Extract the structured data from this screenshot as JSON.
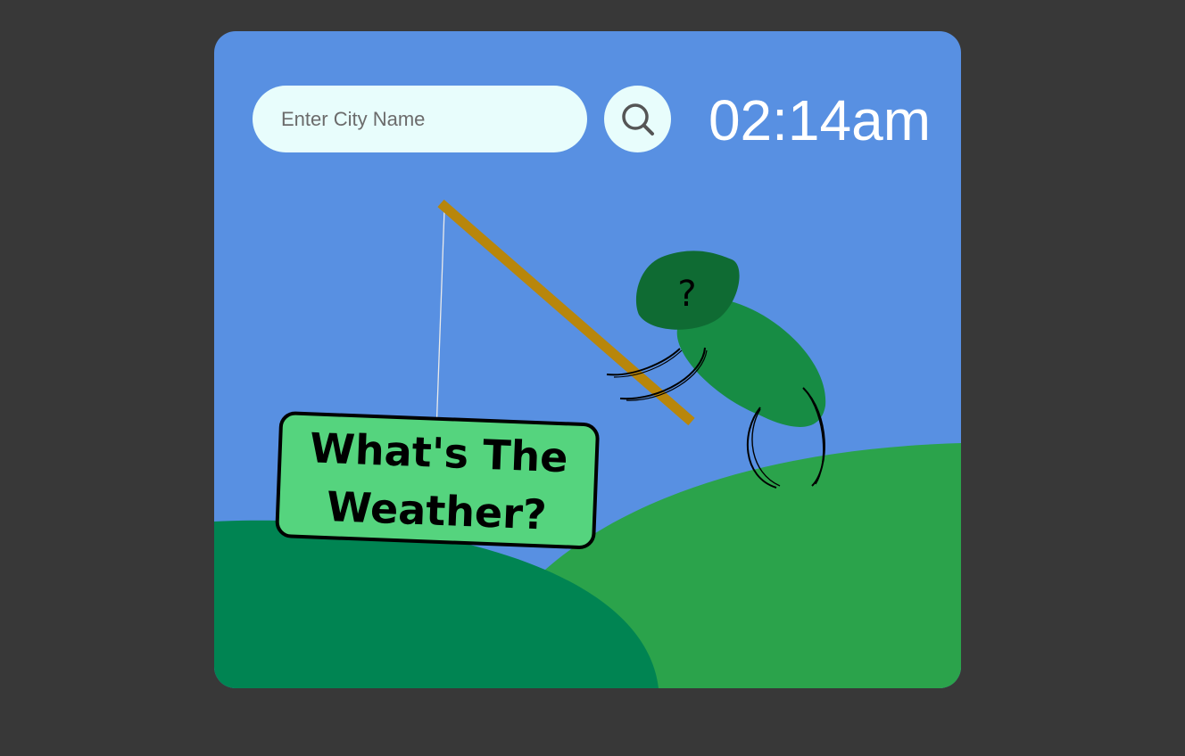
{
  "search": {
    "placeholder": "Enter City Name",
    "value": "",
    "button_icon": "search-icon"
  },
  "clock": {
    "time": "02:14am"
  },
  "sign": {
    "line1": "What's The",
    "line2": "Weather?"
  },
  "character": {
    "head_text": "?"
  },
  "colors": {
    "page_background": "#383838",
    "sky": "#5890e2",
    "hill_back": "#2ba34b",
    "hill_front": "#008452",
    "sign_fill": "#55d47e",
    "rod": "#b8860b",
    "body": "#178c44",
    "head": "#0f6b33",
    "input_background": "#e8fdfc"
  }
}
